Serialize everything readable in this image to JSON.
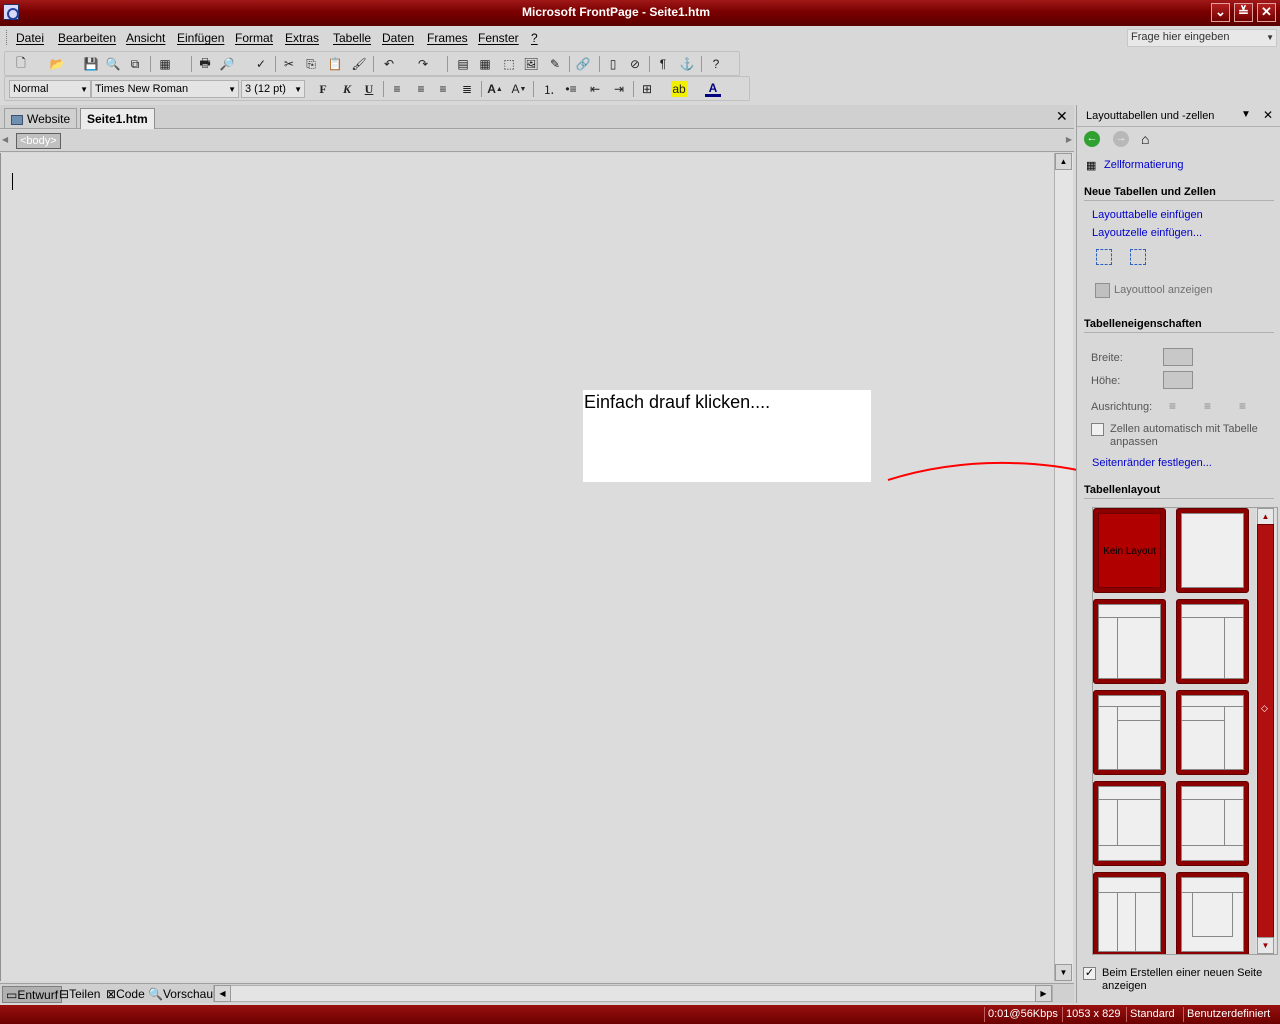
{
  "window": {
    "title": "Microsoft FrontPage - Seite1.htm",
    "controls": [
      "minimize-icon",
      "restore-icon",
      "close-icon"
    ]
  },
  "menu": {
    "items": [
      "Datei",
      "Bearbeiten",
      "Ansicht",
      "Einfügen",
      "Format",
      "Extras",
      "Tabelle",
      "Daten",
      "Frames",
      "Fenster",
      "?"
    ],
    "help_placeholder": "Frage hier eingeben"
  },
  "format_toolbar": {
    "style": "Normal",
    "font": "Times New Roman",
    "size": "3  (12 pt)",
    "bold": "F",
    "italic": "K",
    "underline": "U"
  },
  "tabs": {
    "website": "Website",
    "page": "Seite1.htm"
  },
  "tagbar": {
    "tag": "<body>"
  },
  "annotation": {
    "callout_text": "Einfach drauf klicken....",
    "marker_color": "#ff0000"
  },
  "view_tabs": [
    "Entwurf",
    "Teilen",
    "Code",
    "Vorschau"
  ],
  "taskpane": {
    "title": "Layouttabellen und -zellen",
    "cell_formatting": "Zellformatierung",
    "section_new": "Neue Tabellen und Zellen",
    "insert_table": "Layouttabelle einfügen",
    "insert_cell": "Layoutzelle einfügen...",
    "show_tool": "Layouttool anzeigen",
    "section_props": "Tabelleneigenschaften",
    "width_label": "Breite:",
    "height_label": "Höhe:",
    "align_label": "Ausrichtung:",
    "autofit_label": "Zellen automatisch mit Tabelle anpassen",
    "margins_link": "Seitenränder festlegen...",
    "section_layout": "Tabellenlayout",
    "no_layout": "Kein Layout",
    "show_on_new": "Beim Erstellen einer neuen Seite anzeigen",
    "show_on_new_checked": true
  },
  "status": {
    "speed": "0:01@56Kbps",
    "size": "1053 x 829",
    "mode": "Standard",
    "custom": "Benutzerdefiniert"
  },
  "colors": {
    "theme_red": "#8c0000",
    "link_blue": "#0000cc"
  }
}
